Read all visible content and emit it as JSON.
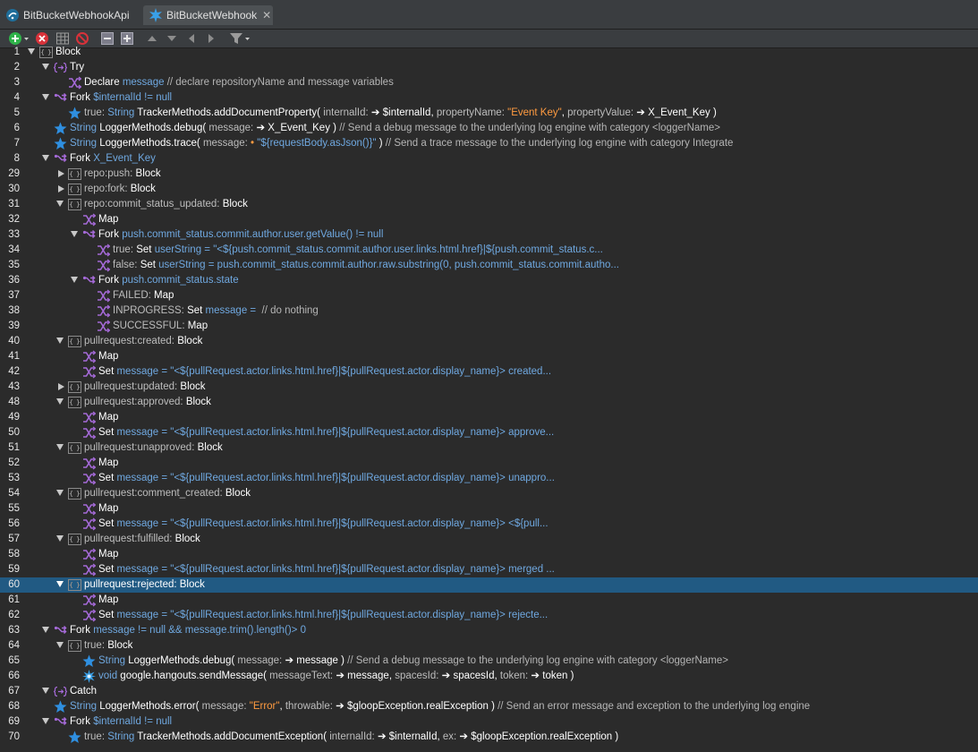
{
  "tabs": [
    {
      "label": "BitBucketWebhookApi",
      "active": false
    },
    {
      "label": "BitBucketWebhook",
      "active": true,
      "close": "✕"
    }
  ],
  "toolbar": {
    "items": [
      "add-icon",
      "remove-icon",
      "grid-icon",
      "disable-icon",
      "collapse-icon",
      "expand-icon",
      "move-up-icon",
      "move-down-icon",
      "move-left-icon",
      "move-right-icon",
      "filter-icon"
    ]
  },
  "colors": {
    "background": "#2b2b2b",
    "selection": "#215a83",
    "blue": "#6fa8e0",
    "orange": "#ff9b40",
    "purple": "#9a55d2",
    "star": "#2f8fe0"
  },
  "selected_line": "60",
  "lines": [
    {
      "n": "1",
      "tw": "open",
      "icon": "block",
      "seg": [
        [
          "k",
          "Block"
        ]
      ]
    },
    {
      "n": "2",
      "tw": "open",
      "icon": "try",
      "seg": [
        [
          "k",
          "Try"
        ]
      ]
    },
    {
      "n": "3",
      "icon": "step",
      "seg": [
        [
          "k",
          "Declare "
        ],
        [
          "b",
          "message"
        ],
        [
          "g",
          " // declare repositoryName and message variables"
        ]
      ]
    },
    {
      "n": "4",
      "tw": "open",
      "icon": "fork",
      "seg": [
        [
          "k",
          "Fork "
        ],
        [
          "b",
          "$internalId != null"
        ]
      ]
    },
    {
      "n": "5",
      "icon": "star",
      "seg": [
        [
          "lb",
          "true: "
        ],
        [
          "b",
          "String "
        ],
        [
          "k",
          "TrackerMethods.addDocumentProperty( "
        ],
        [
          "lb",
          "internalId: "
        ],
        [
          "k",
          "➔ $internalId, "
        ],
        [
          "lb",
          "propertyName: "
        ],
        [
          "o",
          "\"Event Key\""
        ],
        [
          "k",
          ", "
        ],
        [
          "lb",
          "propertyValue: "
        ],
        [
          "k",
          "➔ X_Event_Key )"
        ]
      ]
    },
    {
      "n": "6",
      "icon": "star",
      "seg": [
        [
          "b",
          "String "
        ],
        [
          "k",
          "LoggerMethods.debug( "
        ],
        [
          "lb",
          "message: "
        ],
        [
          "k",
          "➔ X_Event_Key ) "
        ],
        [
          "g",
          "// Send a debug message to the underlying log engine with category <loggerName>"
        ]
      ]
    },
    {
      "n": "7",
      "icon": "star",
      "seg": [
        [
          "b",
          "String "
        ],
        [
          "k",
          "LoggerMethods.trace( "
        ],
        [
          "lb",
          "message: "
        ],
        [
          "o",
          "• "
        ],
        [
          "b",
          "\"${requestBody.asJson()}\""
        ],
        [
          "k",
          " ) "
        ],
        [
          "g",
          "// Send a trace message to the underlying log engine with category Integrate"
        ]
      ]
    },
    {
      "n": "8",
      "tw": "open",
      "icon": "fork",
      "seg": [
        [
          "k",
          "Fork "
        ],
        [
          "b",
          "X_Event_Key"
        ]
      ]
    },
    {
      "n": "29",
      "tw": "closed",
      "icon": "block",
      "seg": [
        [
          "lb",
          "repo:push: "
        ],
        [
          "k",
          "Block"
        ]
      ]
    },
    {
      "n": "30",
      "tw": "closed",
      "icon": "block",
      "seg": [
        [
          "lb",
          "repo:fork: "
        ],
        [
          "k",
          "Block"
        ]
      ]
    },
    {
      "n": "31",
      "tw": "open",
      "icon": "block",
      "seg": [
        [
          "lb",
          "repo:commit_status_updated: "
        ],
        [
          "k",
          "Block"
        ]
      ]
    },
    {
      "n": "32",
      "icon": "step",
      "seg": [
        [
          "k",
          "Map"
        ]
      ]
    },
    {
      "n": "33",
      "tw": "open",
      "icon": "fork",
      "seg": [
        [
          "k",
          "Fork "
        ],
        [
          "b",
          "push.commit_status.commit.author.user.getValue() != null"
        ]
      ]
    },
    {
      "n": "34",
      "icon": "step",
      "seg": [
        [
          "lb",
          "true: "
        ],
        [
          "k",
          "Set "
        ],
        [
          "b",
          "userString = \"<${push.commit_status.commit.author.user.links.html.href}|${push.commit_status.c..."
        ]
      ]
    },
    {
      "n": "35",
      "icon": "step",
      "seg": [
        [
          "lb",
          "false: "
        ],
        [
          "k",
          "Set "
        ],
        [
          "b",
          "userString = push.commit_status.commit.author.raw.substring(0, push.commit_status.commit.autho..."
        ]
      ]
    },
    {
      "n": "36",
      "tw": "open",
      "icon": "fork",
      "seg": [
        [
          "k",
          "Fork "
        ],
        [
          "b",
          "push.commit_status.state"
        ]
      ]
    },
    {
      "n": "37",
      "icon": "step",
      "seg": [
        [
          "lb",
          "FAILED: "
        ],
        [
          "k",
          "Map"
        ]
      ]
    },
    {
      "n": "38",
      "icon": "step",
      "seg": [
        [
          "lb",
          "INPROGRESS: "
        ],
        [
          "k",
          "Set "
        ],
        [
          "b",
          "message = "
        ],
        [
          "g",
          " // do nothing"
        ]
      ]
    },
    {
      "n": "39",
      "icon": "step",
      "seg": [
        [
          "lb",
          "SUCCESSFUL: "
        ],
        [
          "k",
          "Map"
        ]
      ]
    },
    {
      "n": "40",
      "tw": "open",
      "icon": "block",
      "seg": [
        [
          "lb",
          "pullrequest:created: "
        ],
        [
          "k",
          "Block"
        ]
      ]
    },
    {
      "n": "41",
      "icon": "step",
      "seg": [
        [
          "k",
          "Map"
        ]
      ]
    },
    {
      "n": "42",
      "icon": "step",
      "seg": [
        [
          "k",
          "Set "
        ],
        [
          "b",
          "message = \"<${pullRequest.actor.links.html.href}|${pullRequest.actor.display_name}> created..."
        ]
      ]
    },
    {
      "n": "43",
      "tw": "closed",
      "icon": "block",
      "seg": [
        [
          "lb",
          "pullrequest:updated: "
        ],
        [
          "k",
          "Block"
        ]
      ]
    },
    {
      "n": "48",
      "tw": "open",
      "icon": "block",
      "seg": [
        [
          "lb",
          "pullrequest:approved: "
        ],
        [
          "k",
          "Block"
        ]
      ]
    },
    {
      "n": "49",
      "icon": "step",
      "seg": [
        [
          "k",
          "Map"
        ]
      ]
    },
    {
      "n": "50",
      "icon": "step",
      "seg": [
        [
          "k",
          "Set "
        ],
        [
          "b",
          "message = \"<${pullRequest.actor.links.html.href}|${pullRequest.actor.display_name}> approve..."
        ]
      ]
    },
    {
      "n": "51",
      "tw": "open",
      "icon": "block",
      "seg": [
        [
          "lb",
          "pullrequest:unapproved: "
        ],
        [
          "k",
          "Block"
        ]
      ]
    },
    {
      "n": "52",
      "icon": "step",
      "seg": [
        [
          "k",
          "Map"
        ]
      ]
    },
    {
      "n": "53",
      "icon": "step",
      "seg": [
        [
          "k",
          "Set "
        ],
        [
          "b",
          "message = \"<${pullRequest.actor.links.html.href}|${pullRequest.actor.display_name}> unappro..."
        ]
      ]
    },
    {
      "n": "54",
      "tw": "open",
      "icon": "block",
      "seg": [
        [
          "lb",
          "pullrequest:comment_created: "
        ],
        [
          "k",
          "Block"
        ]
      ]
    },
    {
      "n": "55",
      "icon": "step",
      "seg": [
        [
          "k",
          "Map"
        ]
      ]
    },
    {
      "n": "56",
      "icon": "step",
      "seg": [
        [
          "k",
          "Set "
        ],
        [
          "b",
          "message = \"<${pullRequest.actor.links.html.href}|${pullRequest.actor.display_name}> <${pull..."
        ]
      ]
    },
    {
      "n": "57",
      "tw": "open",
      "icon": "block",
      "seg": [
        [
          "lb",
          "pullrequest:fulfilled: "
        ],
        [
          "k",
          "Block"
        ]
      ]
    },
    {
      "n": "58",
      "icon": "step",
      "seg": [
        [
          "k",
          "Map"
        ]
      ]
    },
    {
      "n": "59",
      "icon": "step",
      "seg": [
        [
          "k",
          "Set "
        ],
        [
          "b",
          "message = \"<${pullRequest.actor.links.html.href}|${pullRequest.actor.display_name}> merged ..."
        ]
      ]
    },
    {
      "n": "60",
      "tw": "open",
      "icon": "block",
      "seg": [
        [
          "k",
          "pullrequest:rejected: Block"
        ]
      ]
    },
    {
      "n": "61",
      "icon": "step",
      "seg": [
        [
          "k",
          "Map"
        ]
      ]
    },
    {
      "n": "62",
      "icon": "step",
      "seg": [
        [
          "k",
          "Set "
        ],
        [
          "b",
          "message = \"<${pullRequest.actor.links.html.href}|${pullRequest.actor.display_name}> rejecte..."
        ]
      ]
    },
    {
      "n": "63",
      "tw": "open",
      "icon": "fork",
      "seg": [
        [
          "k",
          "Fork "
        ],
        [
          "b",
          "message != null && message.trim().length()> 0"
        ]
      ]
    },
    {
      "n": "64",
      "tw": "open",
      "icon": "block",
      "seg": [
        [
          "lb",
          "true: "
        ],
        [
          "k",
          "Block"
        ]
      ]
    },
    {
      "n": "65",
      "icon": "star",
      "seg": [
        [
          "b",
          "String "
        ],
        [
          "k",
          "LoggerMethods.debug( "
        ],
        [
          "lb",
          "message: "
        ],
        [
          "k",
          "➔ message ) "
        ],
        [
          "g",
          "// Send a debug message to the underlying log engine with category <loggerName>"
        ]
      ]
    },
    {
      "n": "66",
      "icon": "burst",
      "seg": [
        [
          "b",
          "void "
        ],
        [
          "k",
          "google.hangouts.sendMessage( "
        ],
        [
          "lb",
          "messageText: "
        ],
        [
          "k",
          "➔ message, "
        ],
        [
          "lb",
          "spacesId: "
        ],
        [
          "k",
          "➔ spacesId, "
        ],
        [
          "lb",
          "token: "
        ],
        [
          "k",
          "➔ token )"
        ]
      ]
    },
    {
      "n": "67",
      "tw": "open",
      "icon": "try",
      "seg": [
        [
          "k",
          "Catch"
        ]
      ]
    },
    {
      "n": "68",
      "icon": "star",
      "seg": [
        [
          "b",
          "String "
        ],
        [
          "k",
          "LoggerMethods.error( "
        ],
        [
          "lb",
          "message: "
        ],
        [
          "o",
          "\"Error\""
        ],
        [
          "k",
          ", "
        ],
        [
          "lb",
          "throwable: "
        ],
        [
          "k",
          "➔ $gloopException.realException ) "
        ],
        [
          "g",
          "// Send an error message and exception to the underlying log engine"
        ]
      ]
    },
    {
      "n": "69",
      "tw": "open",
      "icon": "fork",
      "seg": [
        [
          "k",
          "Fork "
        ],
        [
          "b",
          "$internalId != null"
        ]
      ]
    },
    {
      "n": "70",
      "icon": "star",
      "seg": [
        [
          "lb",
          "true: "
        ],
        [
          "b",
          "String "
        ],
        [
          "k",
          "TrackerMethods.addDocumentException( "
        ],
        [
          "lb",
          "internalId: "
        ],
        [
          "k",
          "➔ $internalId, "
        ],
        [
          "lb",
          "ex: "
        ],
        [
          "k",
          "➔ $gloopException.realException )"
        ]
      ]
    }
  ]
}
